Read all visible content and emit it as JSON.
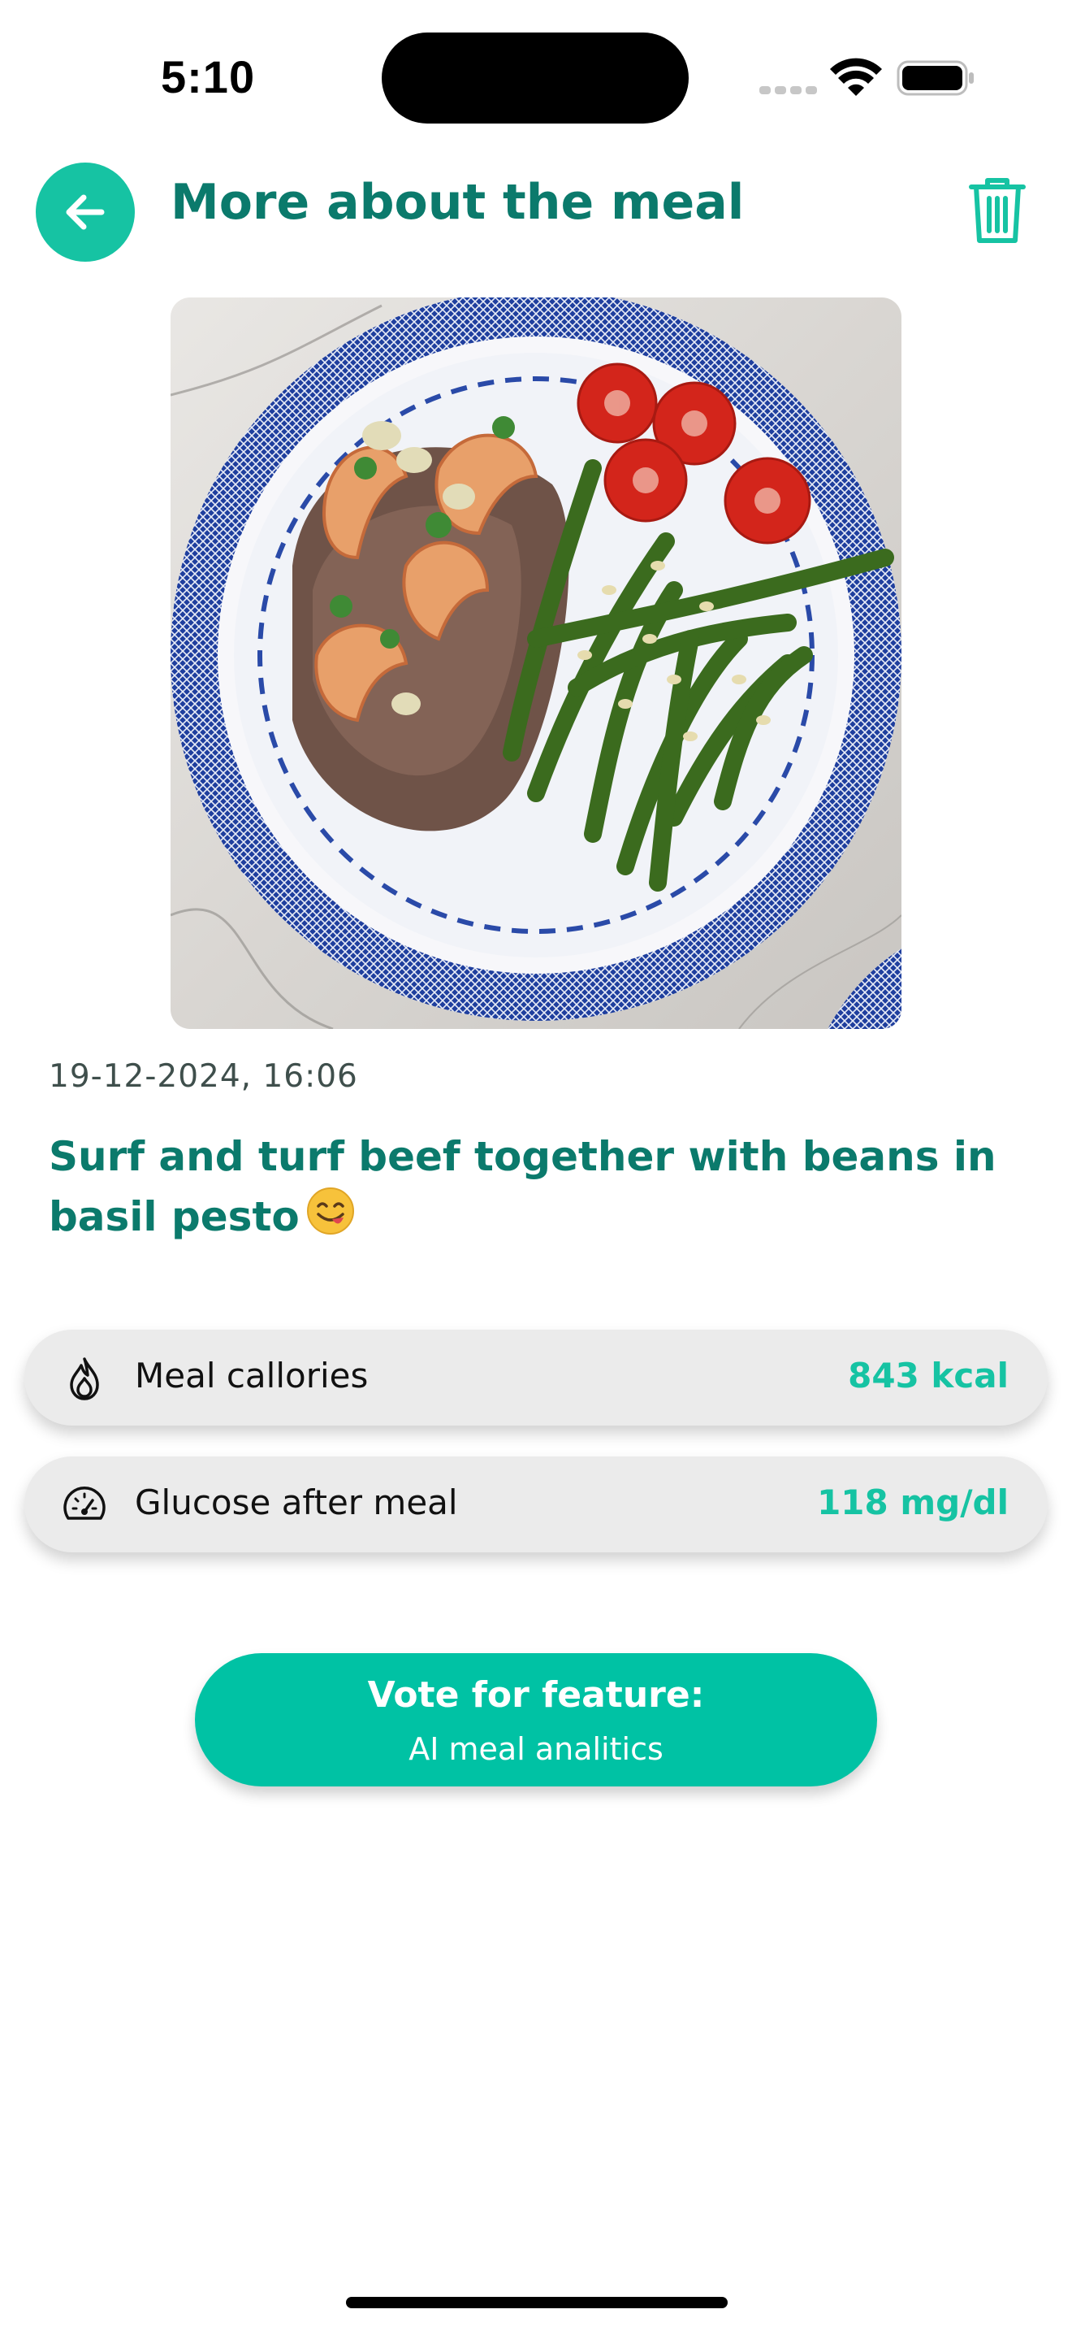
{
  "status_bar": {
    "time": "5:10"
  },
  "header": {
    "title": "More about the meal",
    "back_icon": "arrow-left-icon",
    "delete_icon": "trash-icon"
  },
  "meal": {
    "photo_alt": "meal-photo",
    "datetime": "19-12-2024, 16:06",
    "description": "Surf and turf beef together with beans in basil pesto",
    "emoji": "face-savoring-food-emoji"
  },
  "stats": [
    {
      "icon": "flame-icon",
      "label": "Meal callories",
      "value": "843 kcal"
    },
    {
      "icon": "speedometer-icon",
      "label": "Glucose after meal",
      "value": "118 mg/dl"
    }
  ],
  "vote_button": {
    "title": "Vote for feature:",
    "subtitle": "AI meal analitics"
  },
  "colors": {
    "accent": "#16c3a3",
    "title": "#0b7a6c",
    "row_bg": "#ebebeb"
  }
}
